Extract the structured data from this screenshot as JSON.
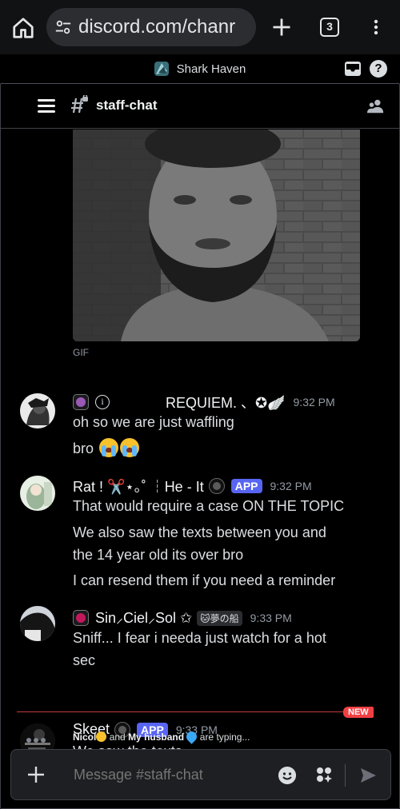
{
  "browser": {
    "url": "discord.com/chanr",
    "tab_count": "3"
  },
  "server": {
    "name": "Shark Haven"
  },
  "channel": {
    "name": "staff-chat"
  },
  "gif": {
    "label": "GIF"
  },
  "messages": [
    {
      "username": "REQUIEM. 、✪🪽",
      "timestamp": "9:32 PM",
      "role_color": "#9b59b6",
      "lines": [
        "oh so we are just waffling",
        "bro"
      ]
    },
    {
      "username": "Rat ! ✂️⋆｡˚ ┆He - It",
      "badge": "APP",
      "timestamp": "9:32 PM",
      "lines": [
        "That would require a case ON THE TOPIC",
        "We also saw the texts between you and",
        "the 14 year old its over bro",
        "I can resend them if you need a reminder"
      ]
    },
    {
      "username": "Sin⸝Ciel⸝Sol ✩",
      "tag": "🐱夢の船",
      "timestamp": "9:33 PM",
      "role_color": "#c2185b",
      "lines": [
        "Sniff... I fear i needa just watch for a hot",
        "sec"
      ]
    },
    {
      "username": "Skeet",
      "badge": "APP",
      "timestamp": "9:33 PM",
      "lines": [
        "We saw the texts...."
      ]
    }
  ],
  "new_marker": "NEW",
  "typing": {
    "user1": "Nicol",
    "connector": "and",
    "user2": "My husband",
    "suffix": "are typing..."
  },
  "composer": {
    "placeholder": "Message #staff-chat"
  },
  "colors": {
    "accent": "#5865f2",
    "new": "#f23f43"
  }
}
